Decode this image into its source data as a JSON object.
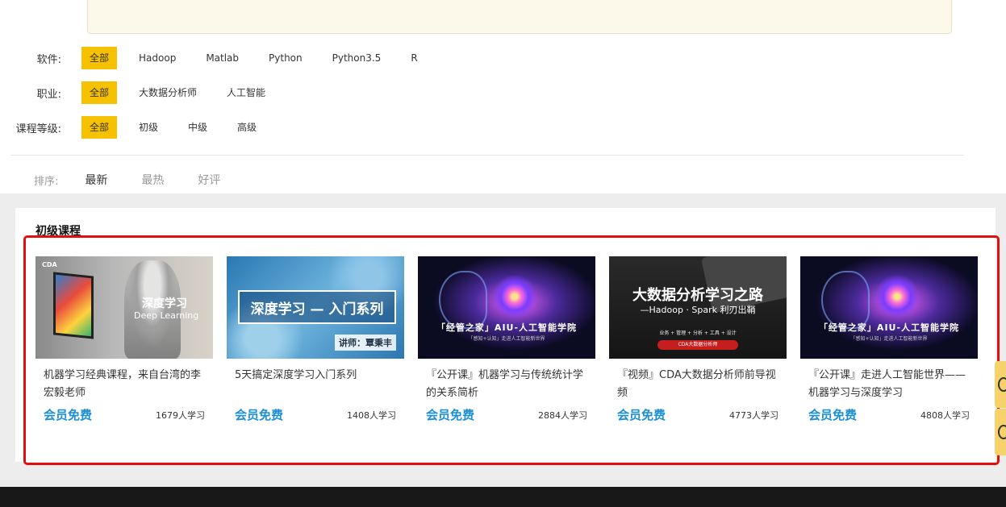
{
  "filters": {
    "software": {
      "label": "软件:",
      "options": [
        "全部",
        "Hadoop",
        "Matlab",
        "Python",
        "Python3.5",
        "R"
      ]
    },
    "career": {
      "label": "职业:",
      "options": [
        "全部",
        "大数据分析师",
        "人工智能"
      ]
    },
    "level": {
      "label": "课程等级:",
      "options": [
        "全部",
        "初级",
        "中级",
        "高级"
      ]
    }
  },
  "sort": {
    "label": "排序:",
    "options": [
      "最新",
      "最热",
      "好评"
    ]
  },
  "section": {
    "title": "初级课程"
  },
  "thumbs": {
    "c1": {
      "logo": "CDA",
      "title": "深度学习",
      "subtitle": "Deep Learning"
    },
    "c2": {
      "title": "深度学习 — 入门系列",
      "lecturer": "讲师：覃秉丰"
    },
    "c3": {
      "title": "「经管之家」AIU-人工智能学院",
      "sub": "「感知+认知」走进人工智能新世界"
    },
    "c4": {
      "title": "大数据分析学习之路",
      "sub": "—Hadoop · Spark 利刃出鞘",
      "line": "业务 + 管理 + 分析 + 工具 + 设计",
      "pill": "CDA大数据分析师"
    },
    "c5": {
      "title": "「经管之家」AIU-人工智能学院",
      "sub": "「感知+认知」走进人工智能新世界"
    }
  },
  "courses": [
    {
      "title": "机器学习经典课程，来自台湾的李宏毅老师",
      "price": "会员免费",
      "count": "1679人学习"
    },
    {
      "title": "5天搞定深度学习入门系列",
      "price": "会员免费",
      "count": "1408人学习"
    },
    {
      "title": "『公开课』机器学习与传统统计学的关系简析",
      "price": "会员免费",
      "count": "2884人学习"
    },
    {
      "title": "『视频』CDA大数据分析师前导视频",
      "price": "会员免费",
      "count": "4773人学习"
    },
    {
      "title": "『公开课』走进人工智能世界——机器学习与深度学习",
      "price": "会员免费",
      "count": "4808人学习"
    }
  ],
  "colors": {
    "accent": "#f6c100",
    "price": "#1a8fd8",
    "highlight": "#e01010"
  }
}
